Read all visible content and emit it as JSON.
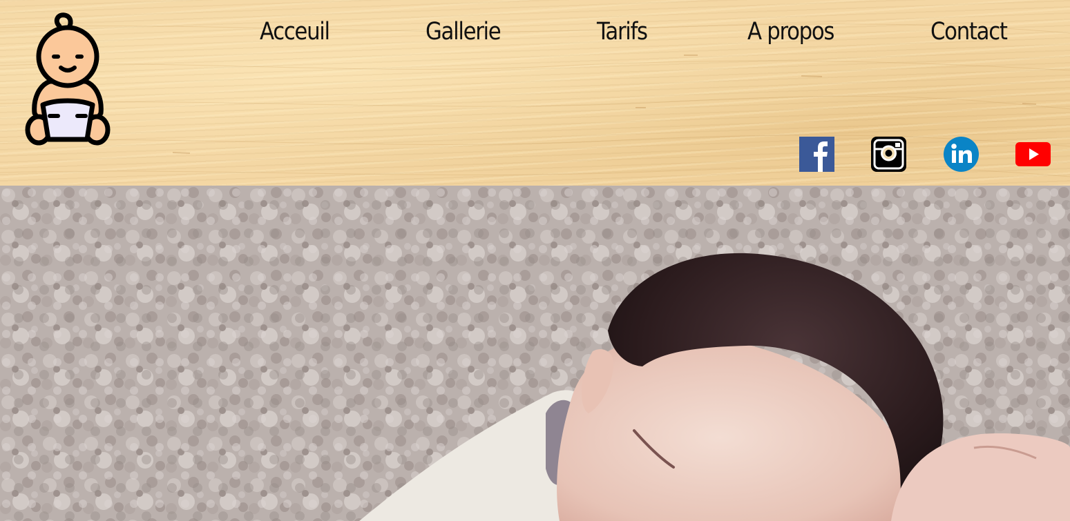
{
  "brand": {
    "logo_icon": "baby-in-diaper-icon"
  },
  "nav": {
    "items": [
      {
        "label": "Acceuil"
      },
      {
        "label": "Gallerie"
      },
      {
        "label": "Tarifs"
      },
      {
        "label": "A propos"
      },
      {
        "label": "Contact"
      }
    ]
  },
  "social": [
    {
      "icon": "facebook-icon",
      "color": "#3b5998"
    },
    {
      "icon": "instagram-icon",
      "color": "#000000"
    },
    {
      "icon": "linkedin-icon",
      "color": "#0a84c6"
    },
    {
      "icon": "youtube-icon",
      "color": "#ff0000"
    }
  ],
  "hero": {
    "image": "sleeping-newborn-photo"
  },
  "colors": {
    "header_bg": "#f4d7a4",
    "nav_text": "#111111",
    "logo_skin": "#fbc89a",
    "logo_diaper": "#ece9fb"
  }
}
